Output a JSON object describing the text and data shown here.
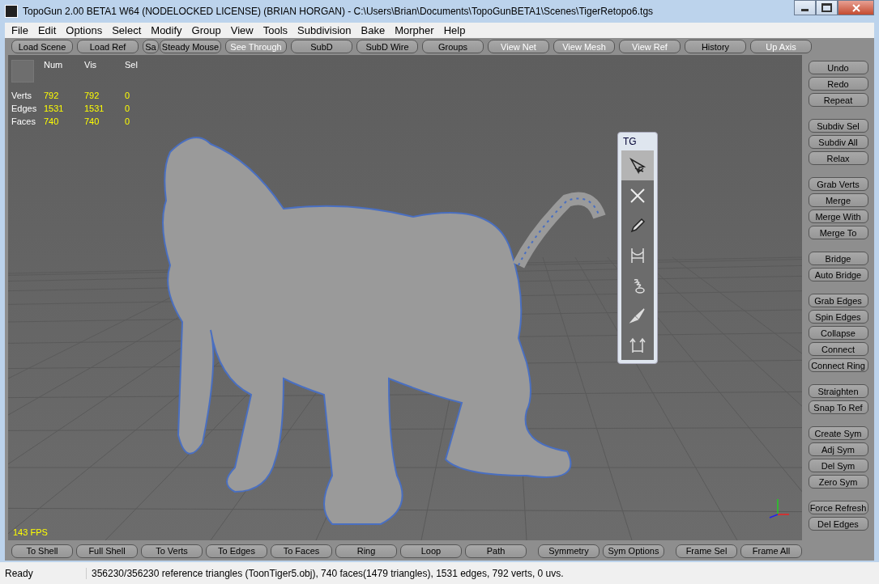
{
  "window": {
    "title": "TopoGun 2.00 BETA1 W64  (NODELOCKED LICENSE) (BRIAN HORGAN) - C:\\Users\\Brian\\Documents\\TopoGunBETA1\\Scenes\\TigerRetopo6.tgs"
  },
  "menu": [
    "File",
    "Edit",
    "Options",
    "Select",
    "Modify",
    "Group",
    "View",
    "Tools",
    "Subdivision",
    "Bake",
    "Morpher",
    "Help"
  ],
  "top_toolbar": [
    {
      "label": "Load Scene",
      "active": false
    },
    {
      "label": "Load Ref",
      "active": false
    },
    {
      "label": "Sa",
      "active": false
    },
    {
      "label": "Steady Mouse",
      "active": false
    },
    {
      "label": "See Through",
      "active": true
    },
    {
      "label": "SubD",
      "active": false
    },
    {
      "label": "SubD Wire",
      "active": false
    },
    {
      "label": "Groups",
      "active": false
    },
    {
      "label": "View Net",
      "active": true
    },
    {
      "label": "View Mesh",
      "active": true
    },
    {
      "label": "View Ref",
      "active": true
    },
    {
      "label": "History",
      "active": false
    },
    {
      "label": "Up Axis",
      "active": true
    }
  ],
  "stats": {
    "columns": [
      "Num",
      "Vis",
      "Sel"
    ],
    "rows": [
      {
        "label": "Verts",
        "values": [
          "792",
          "792",
          "0"
        ]
      },
      {
        "label": "Edges",
        "values": [
          "1531",
          "1531",
          "0"
        ]
      },
      {
        "label": "Faces",
        "values": [
          "740",
          "740",
          "0"
        ]
      }
    ]
  },
  "fps": "143 FPS",
  "tool_palette": {
    "title": "TG",
    "tools": [
      {
        "kind": "select",
        "selected": true
      },
      {
        "kind": "delete",
        "selected": false
      },
      {
        "kind": "pen",
        "selected": false
      },
      {
        "kind": "bridge",
        "selected": false
      },
      {
        "kind": "spring",
        "selected": false
      },
      {
        "kind": "brush",
        "selected": false
      },
      {
        "kind": "connect",
        "selected": false
      }
    ]
  },
  "right_panel": [
    [
      "Undo",
      "Redo",
      "Repeat"
    ],
    [
      "Subdiv Sel",
      "Subdiv All",
      "Relax"
    ],
    [
      "Grab Verts",
      "Merge",
      "Merge With",
      "Merge To"
    ],
    [
      "Bridge",
      "Auto Bridge"
    ],
    [
      "Grab Edges",
      "Spin Edges",
      "Collapse",
      "Connect",
      "Connect Ring"
    ],
    [
      "Straighten",
      "Snap To Ref"
    ],
    [
      "Create Sym",
      "Adj Sym",
      "Del Sym",
      "Zero Sym"
    ],
    [
      "Force Refresh",
      "Del Edges"
    ]
  ],
  "bottom_toolbar": [
    [
      "To Shell",
      "Full Shell",
      "To Verts",
      "To Edges",
      "To Faces",
      "Ring",
      "Loop",
      "Path"
    ],
    [
      "Symmetry",
      "Sym Options"
    ],
    [
      "Frame Sel",
      "Frame All"
    ]
  ],
  "status_bar": {
    "state": "Ready",
    "message": "356230/356230 reference triangles (ToonTiger5.obj), 740 faces(1479 triangles), 1531 edges, 792 verts, 0 uvs."
  }
}
